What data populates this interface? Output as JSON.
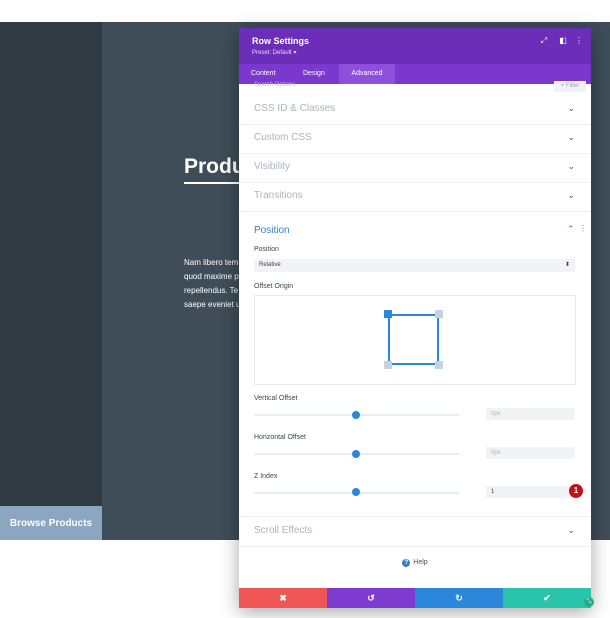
{
  "background": {
    "title": "Produc",
    "text_lines": [
      "Nam libero tem",
      "quod maxime p",
      "repellendus. Te",
      "saepe eveniet u"
    ],
    "browse_button": "Browse Products"
  },
  "modal": {
    "title": "Row Settings",
    "preset": "Preset: Default ▾",
    "header_icons": [
      "expand-icon",
      "split-view-icon",
      "more-icon"
    ],
    "tabs": [
      "Content",
      "Design",
      "Advanced"
    ],
    "active_tab": "Advanced",
    "search_placeholder": "Search Options",
    "filter_label": "+ Filter",
    "sections_collapsed": [
      "CSS ID & Classes",
      "Custom CSS",
      "Visibility",
      "Transitions"
    ],
    "position": {
      "title": "Position",
      "position_label": "Position",
      "position_value": "Relative",
      "offset_origin_label": "Offset Origin",
      "vertical_offset_label": "Vertical Offset",
      "vertical_offset_value": "0px",
      "horizontal_offset_label": "Horizontal Offset",
      "horizontal_offset_value": "0px",
      "z_index_label": "Z Index",
      "z_index_value": "1"
    },
    "badge": "1",
    "scroll_effects": "Scroll Effects",
    "help": "Help",
    "footer_buttons": [
      {
        "name": "cancel",
        "symbol": "✖",
        "color": "#ef5555"
      },
      {
        "name": "undo",
        "symbol": "↺",
        "color": "#7e3bd0"
      },
      {
        "name": "redo",
        "symbol": "↻",
        "color": "#2b87da"
      },
      {
        "name": "save",
        "symbol": "✔",
        "color": "#29c4a9"
      }
    ]
  },
  "colors": {
    "header_purple": "#6c2eb9",
    "tab_purple": "#7b38cf",
    "accent_blue": "#2b87da",
    "badge_red": "#c1121b"
  }
}
